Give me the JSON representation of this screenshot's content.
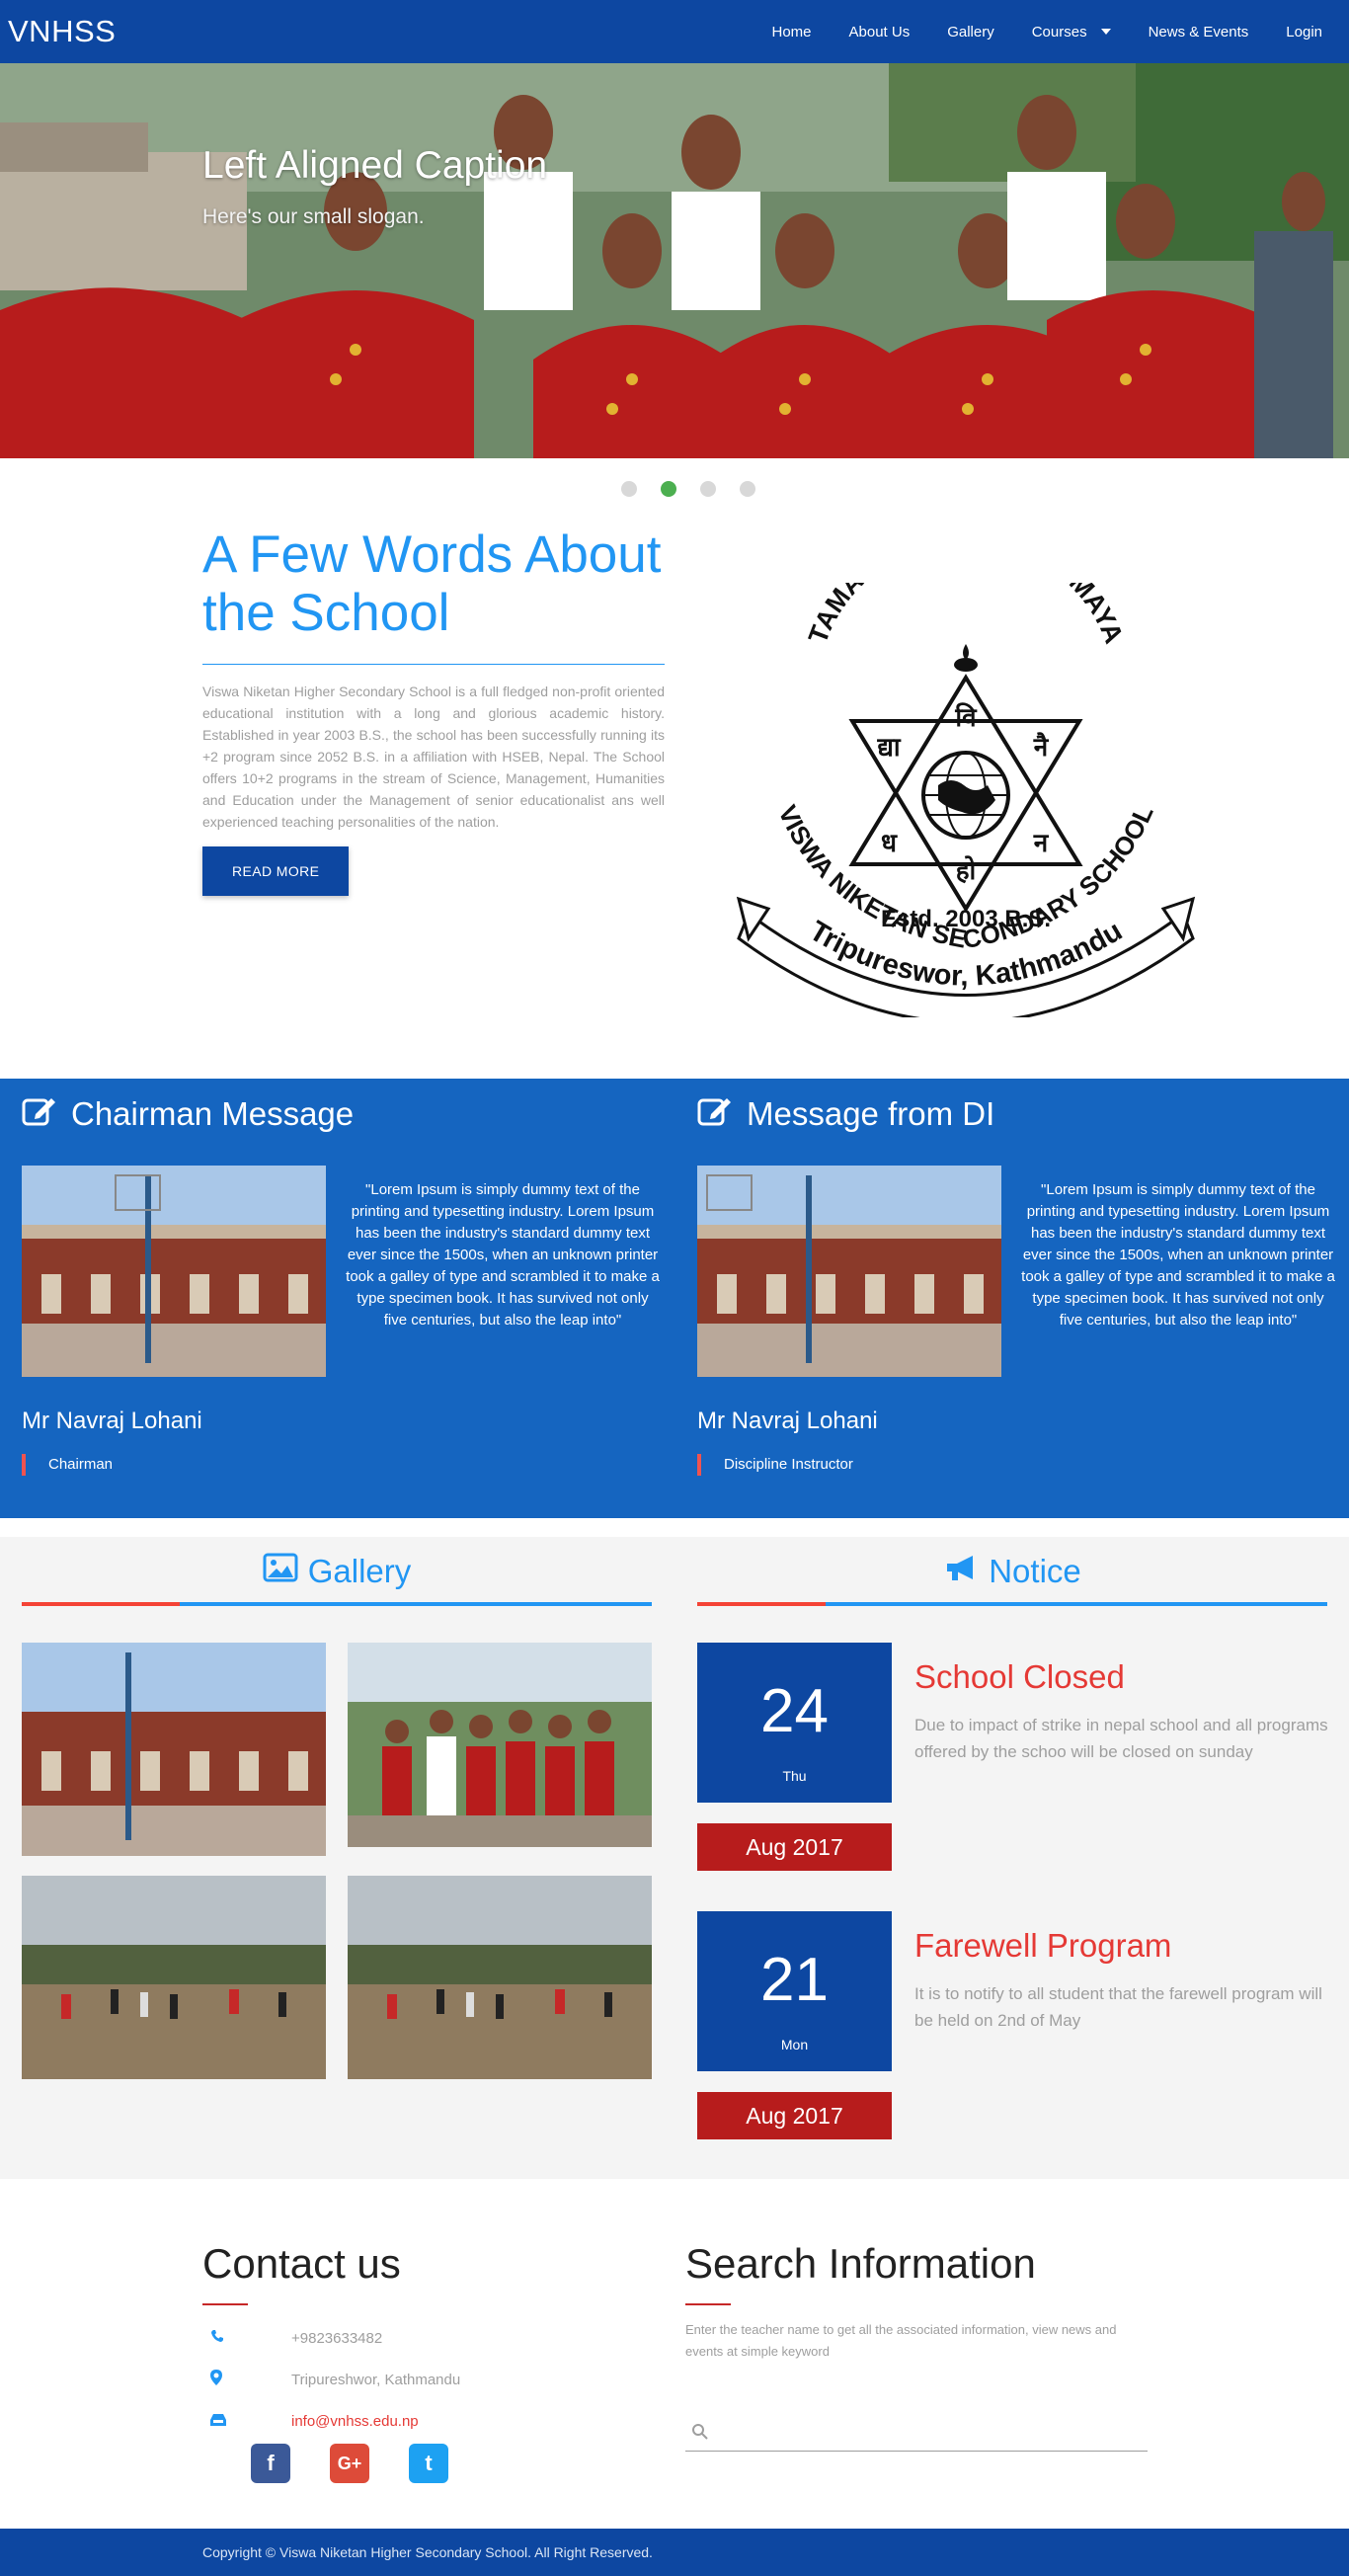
{
  "navbar": {
    "brand": "VNHSS",
    "items": [
      {
        "label": "Home"
      },
      {
        "label": "About Us"
      },
      {
        "label": "Gallery"
      },
      {
        "label": "Courses"
      },
      {
        "label": "News & Events"
      },
      {
        "label": "Login"
      }
    ]
  },
  "hero": {
    "title": "Left Aligned Caption",
    "slogan": "Here's our small slogan.",
    "active_slide": 2,
    "slide_count": 4
  },
  "about": {
    "title": "A Few Words About the School",
    "text": "Viswa Niketan Higher Secondary School is a full fledged non-profit oriented educational institution with a long and glorious academic history. Established in year 2003 B.S., the school has been successfully running its +2 program since 2052 B.S. in a affiliation with HSEB, Nepal. The School offers 10+2 programs in the stream of Science, Management, Humanities and Education under the Management of senior educationalist ans well experienced teaching personalities of the nation.",
    "button": "READ MORE",
    "logo": {
      "top_text": "TAMASOMA JYOTIRGAMAYA",
      "established": "Estd. 2003 B.S.",
      "ribbon_text": "VISWA NIKETAN SECONDARY SCHOOL",
      "bottom_text": "Tripureswor, Kathmandu",
      "glyphs": [
        "वि",
        "द्या",
        "नै",
        "ध",
        "न",
        "हो"
      ]
    }
  },
  "messages": [
    {
      "title": "Chairman Message",
      "quote": "\"Lorem Ipsum is simply dummy text of the printing and typesetting industry. Lorem Ipsum has been the industry's standard dummy text ever since the 1500s, when an unknown printer took a galley of type and scrambled it to make a type specimen book. It has survived not only five centuries, but also the leap into\"",
      "name": "Mr Navraj Lohani",
      "role": "Chairman"
    },
    {
      "title": "Message from DI",
      "quote": "\"Lorem Ipsum is simply dummy text of the printing and typesetting industry. Lorem Ipsum has been the industry's standard dummy text ever since the 1500s, when an unknown printer took a galley of type and scrambled it to make a type specimen book. It has survived not only five centuries, but also the leap into\"",
      "name": "Mr Navraj Lohani",
      "role": "Discipline Instructor"
    }
  ],
  "gallery": {
    "title": "Gallery"
  },
  "notice": {
    "title": "Notice",
    "items": [
      {
        "day": "24",
        "weekday": "Thu",
        "month": "Aug 2017",
        "title": "School Closed",
        "desc": "Due to impact of strike in nepal school and all programs offered by the schoo will be closed on sunday"
      },
      {
        "day": "21",
        "weekday": "Mon",
        "month": "Aug 2017",
        "title": "Farewell Program",
        "desc": "It is to notify to all student that the farewell program will be held on 2nd of May"
      }
    ]
  },
  "contact": {
    "title": "Contact us",
    "phone": "+9823633482",
    "address": "Tripureshwor, Kathmandu",
    "email": "info@vnhss.edu.np",
    "socials": [
      "f",
      "G+",
      "t"
    ]
  },
  "search": {
    "title": "Search Information",
    "text": "Enter the teacher name to get all the associated information, view news and events at simple keyword",
    "placeholder": ""
  },
  "footer": {
    "text": "Copyright © Viswa Niketan Higher Secondary School. All Right Reserved."
  },
  "colors": {
    "nav": "#0d47a1",
    "accent": "#2196f3",
    "message_bg": "#1565c0",
    "red": "#e53935",
    "dark_red": "#b71c1c"
  }
}
